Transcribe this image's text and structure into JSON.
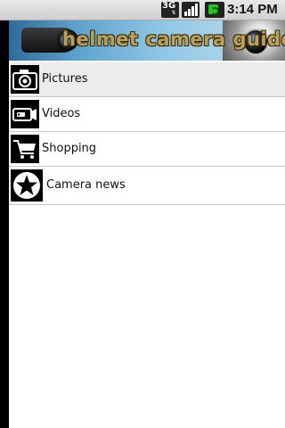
{
  "status_bar": {
    "network": "3G",
    "network_sub": "⇅",
    "time": "3:14 PM",
    "icons": [
      "network-3g-icon",
      "signal-strength-icon",
      "battery-charging-icon"
    ]
  },
  "banner": {
    "title": "helmet camera guide"
  },
  "menu": {
    "items": [
      {
        "label": "Pictures",
        "icon": "camera-icon",
        "selected": true
      },
      {
        "label": "Videos",
        "icon": "video-camera-icon",
        "selected": false
      },
      {
        "label": "Shopping",
        "icon": "shopping-cart-icon",
        "selected": false
      },
      {
        "label": "Camera news",
        "icon": "star-icon",
        "selected": false
      }
    ]
  },
  "colors": {
    "background": "#ffffff",
    "selected_row": "#ececec",
    "divider": "#c8c8c8",
    "left_strip": "#000000",
    "banner_title": "#b8a15a"
  }
}
